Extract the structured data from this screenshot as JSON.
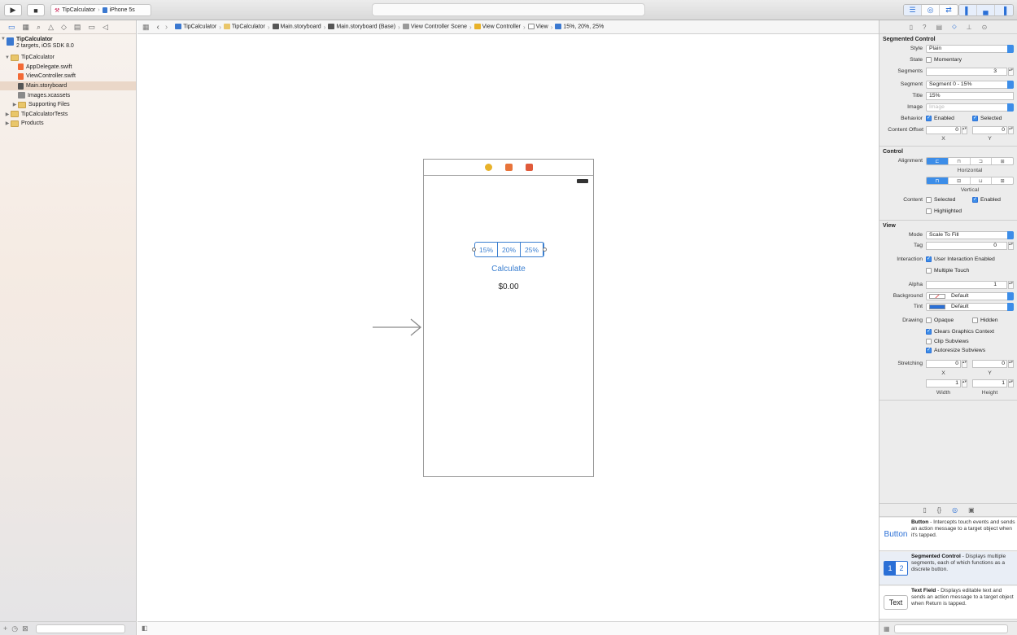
{
  "toolbar": {
    "run_icon": "play-icon",
    "stop_icon": "stop-icon",
    "scheme": "TipCalculator",
    "device": "iPhone 5s",
    "editor_buttons": [
      "standard-editor-icon",
      "assistant-editor-icon",
      "version-editor-icon"
    ],
    "view_buttons": [
      "navigator-toggle-icon",
      "debug-toggle-icon",
      "utilities-toggle-icon"
    ]
  },
  "navigator": {
    "tab_icons": [
      "folder-icon",
      "symbol-icon",
      "search-icon",
      "warning-icon",
      "test-icon",
      "debug-icon",
      "breakpoint-icon",
      "log-icon"
    ],
    "project": {
      "name": "TipCalculator",
      "subtitle": "2 targets, iOS SDK 8.0"
    },
    "items": [
      {
        "label": "TipCalculator",
        "type": "folder",
        "indent": 1,
        "disclosure": "▼"
      },
      {
        "label": "AppDelegate.swift",
        "type": "swift",
        "indent": 2,
        "disclosure": ""
      },
      {
        "label": "ViewController.swift",
        "type": "swift",
        "indent": 2,
        "disclosure": ""
      },
      {
        "label": "Main.storyboard",
        "type": "story",
        "indent": 2,
        "disclosure": "",
        "selected": true
      },
      {
        "label": "Images.xcassets",
        "type": "assets",
        "indent": 2,
        "disclosure": ""
      },
      {
        "label": "Supporting Files",
        "type": "folder",
        "indent": 2,
        "disclosure": "▶"
      },
      {
        "label": "TipCalculatorTests",
        "type": "folder",
        "indent": 1,
        "disclosure": "▶"
      },
      {
        "label": "Products",
        "type": "folder",
        "indent": 1,
        "disclosure": "▶"
      }
    ]
  },
  "jumpbar": {
    "items": [
      "TipCalculator",
      "TipCalculator",
      "Main.storyboard",
      "Main.storyboard (Base)",
      "View Controller Scene",
      "View Controller",
      "View",
      "15%, 20%, 25%"
    ]
  },
  "scene": {
    "segments": [
      "15%",
      "20%",
      "25%"
    ],
    "button_label": "Calculate",
    "tip_label": "$0.00"
  },
  "inspector": {
    "segmented_control": {
      "title": "Segmented Control",
      "style_label": "Style",
      "style_value": "Plain",
      "state_label": "State",
      "state_option": "Momentary",
      "segments_label": "Segments",
      "segments_value": "3",
      "segment_label": "Segment",
      "segment_value": "Segment 0 - 15%",
      "title_label": "Title",
      "title_value": "15%",
      "image_label": "Image",
      "image_placeholder": "Image",
      "behavior_label": "Behavior",
      "enabled": "Enabled",
      "selected": "Selected",
      "offset_label": "Content Offset",
      "offset_x": "0",
      "offset_y": "0",
      "x": "X",
      "y": "Y"
    },
    "control": {
      "title": "Control",
      "alignment_label": "Alignment",
      "horizontal": "Horizontal",
      "vertical": "Vertical",
      "content_label": "Content",
      "selected": "Selected",
      "enabled": "Enabled",
      "highlighted": "Highlighted"
    },
    "view": {
      "title": "View",
      "mode_label": "Mode",
      "mode_value": "Scale To Fill",
      "tag_label": "Tag",
      "tag_value": "0",
      "interaction_label": "Interaction",
      "user_interaction": "User Interaction Enabled",
      "multiple_touch": "Multiple Touch",
      "alpha_label": "Alpha",
      "alpha_value": "1",
      "background_label": "Background",
      "background_value": "Default",
      "tint_label": "Tint",
      "tint_value": "Default",
      "tint_color": "#2a6fd6",
      "drawing_label": "Drawing",
      "opaque": "Opaque",
      "hidden": "Hidden",
      "clears": "Clears Graphics Context",
      "clip": "Clip Subviews",
      "autoresize": "Autoresize Subviews",
      "stretching_label": "Stretching",
      "stretch_x": "0",
      "stretch_y": "0",
      "x": "X",
      "y": "Y",
      "width_value": "1",
      "height_value": "1",
      "width": "Width",
      "height": "Height"
    }
  },
  "library": {
    "tab_icons": [
      "file-template-icon",
      "code-snippet-icon",
      "object-library-icon",
      "media-library-icon"
    ],
    "items": [
      {
        "icon_text": "Button",
        "name": "Button",
        "desc": " - Intercepts touch events and sends an action message to a target object when it's tapped."
      },
      {
        "icon_text": "1 2",
        "name": "Segmented Control",
        "desc": " - Displays multiple segments, each of which functions as a discrete button."
      },
      {
        "icon_text": "Text",
        "name": "Text Field",
        "desc": " - Displays editable text and sends an action message to a target object when Return is tapped."
      }
    ]
  },
  "colors": {
    "accent": "#2a6fd6",
    "selection": "#ead7c8"
  }
}
